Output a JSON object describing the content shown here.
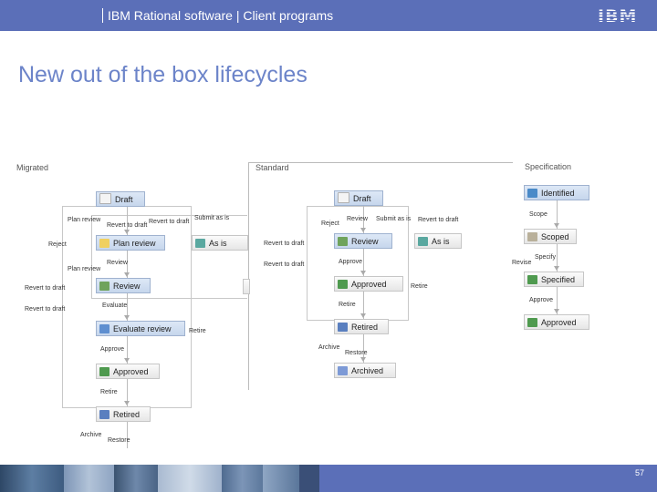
{
  "header": {
    "title": "IBM Rational software  |  Client programs",
    "logo": "IBM"
  },
  "slide": {
    "title": "New out of the box lifecycles",
    "page_number": "57"
  },
  "migrated": {
    "title": "Migrated",
    "states": [
      "Draft",
      "Plan review",
      "Review",
      "Evaluate review",
      "Approved",
      "Retired",
      "As is"
    ],
    "transitions": [
      "Plan review",
      "Revert to draft",
      "Revert to draft",
      "Submit as is",
      "Reject",
      "Review",
      "Plan review",
      "Revert to draft",
      "Evaluate",
      "Revert to draft",
      "Retire",
      "Approve",
      "Retire",
      "Archive",
      "Restore"
    ]
  },
  "standard": {
    "title": "Standard",
    "states": [
      "Draft",
      "Review",
      "As is",
      "Approved",
      "Retired",
      "Archived"
    ],
    "transitions": [
      "Review",
      "Submit as is",
      "Revert to draft",
      "Reject",
      "Revert to draft",
      "Revert to draft",
      "Approve",
      "Retire",
      "Retire",
      "Archive",
      "Restore"
    ]
  },
  "specification": {
    "title": "Specification",
    "states": [
      "Identified",
      "Scoped",
      "Specified",
      "Approved"
    ],
    "transitions": [
      "Scope",
      "Specify",
      "Revise",
      "Approve"
    ]
  },
  "colors": {
    "header_bg": "#5b6fb8",
    "title_text": "#6c84c9"
  }
}
